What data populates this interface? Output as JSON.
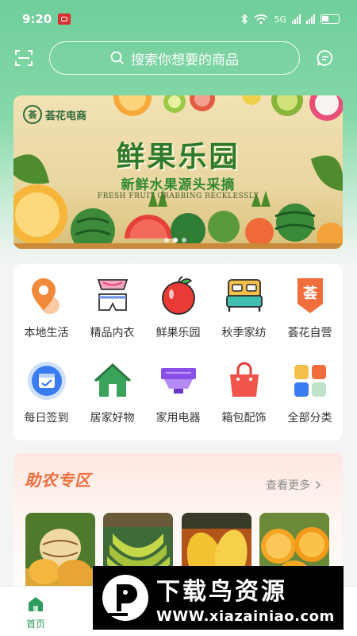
{
  "status_bar": {
    "time": "9:20",
    "network": "5G"
  },
  "search": {
    "placeholder": "搜索你想要的商品"
  },
  "banner": {
    "brand": "荟花电商",
    "brand_seal": "荟",
    "title": "鲜果乐园",
    "subtitle": "新鲜水果源头采摘",
    "english": "FRESH FRUIT GRABBING RECKLESSLY",
    "active_page": 1,
    "page_count": 3
  },
  "categories": [
    {
      "label": "本地生活",
      "icon": "location-pin-icon"
    },
    {
      "label": "精品内衣",
      "icon": "underwear-icon"
    },
    {
      "label": "鲜果乐园",
      "icon": "apple-icon"
    },
    {
      "label": "秋季家纺",
      "icon": "bed-icon"
    },
    {
      "label": "荟花自营",
      "icon": "brand-tag-icon"
    },
    {
      "label": "每日签到",
      "icon": "calendar-check-icon"
    },
    {
      "label": "居家好物",
      "icon": "house-icon"
    },
    {
      "label": "家用电器",
      "icon": "range-hood-icon"
    },
    {
      "label": "箱包配饰",
      "icon": "handbag-icon"
    },
    {
      "label": "全部分类",
      "icon": "grid-icon"
    }
  ],
  "self_brand_char": "荟",
  "zhunong": {
    "title": "助农专区",
    "more": "查看更多"
  },
  "products": [
    {
      "name": "melon-pear",
      "color": "#e8b552"
    },
    {
      "name": "banana",
      "color": "#9fc23a"
    },
    {
      "name": "mango",
      "color": "#f2c33a"
    },
    {
      "name": "orange",
      "color": "#f5a623"
    }
  ],
  "bottom_nav": {
    "home": "首页"
  },
  "watermark": {
    "title": "下载鸟资源",
    "url": "WWW.xiazainiao.com"
  },
  "colors": {
    "brand_green": "#2d9b5c",
    "accent_orange": "#f06d3c"
  }
}
